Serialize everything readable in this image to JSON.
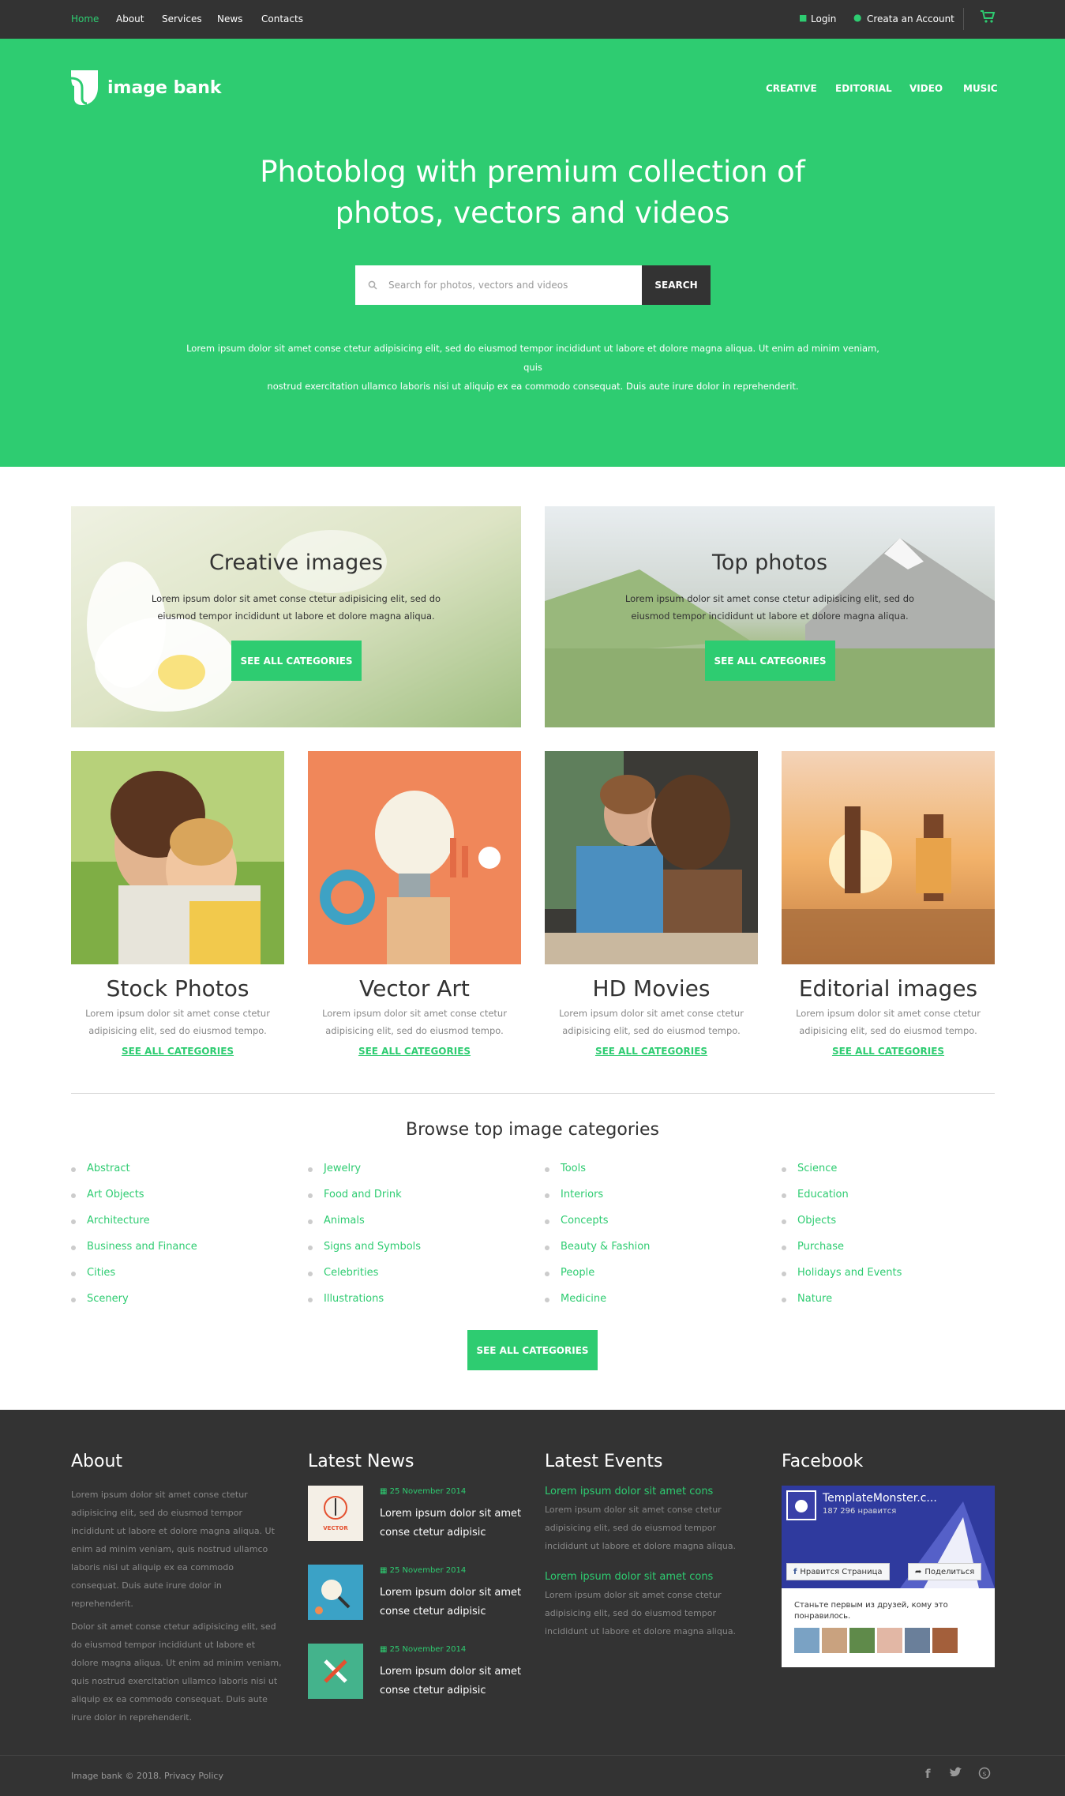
{
  "topbar": {
    "nav": [
      "Home",
      "About",
      "Services",
      "News",
      "Contacts"
    ],
    "login": "Login",
    "create_account": "Creata an Account"
  },
  "brand": {
    "name": "image bank"
  },
  "main_nav": [
    "CREATIVE",
    "EDITORIAL",
    "VIDEO",
    "MUSIC"
  ],
  "hero": {
    "title_line1": "Photoblog with premium collection of",
    "title_line2": "photos, vectors and videos",
    "search_placeholder": "Search for photos, vectors and videos",
    "search_button": "SEARCH",
    "text_line1": "Lorem ipsum dolor sit amet conse ctetur adipisicing elit, sed do eiusmod tempor incididunt ut labore et dolore magna aliqua. Ut enim ad minim veniam, quis",
    "text_line2": "nostrud exercitation ullamco laboris nisi ut aliquip ex ea commodo consequat. Duis aute irure dolor in reprehenderit."
  },
  "banners": [
    {
      "title": "Creative images",
      "text": "Lorem ipsum dolor sit amet conse ctetur adipisicing elit, sed do eiusmod tempor incididunt ut labore et dolore magna aliqua.",
      "button": "SEE ALL CATEGORIES"
    },
    {
      "title": "Top photos",
      "text": "Lorem ipsum dolor sit amet conse ctetur adipisicing elit, sed do eiusmod tempor incididunt ut labore et dolore magna aliqua.",
      "button": "SEE ALL CATEGORIES"
    }
  ],
  "cards": [
    {
      "title": "Stock Photos",
      "text": "Lorem ipsum dolor sit amet conse ctetur adipisicing elit, sed do eiusmod tempo.",
      "link": "SEE ALL CATEGORIES"
    },
    {
      "title": "Vector Art",
      "text": "Lorem ipsum dolor sit amet conse ctetur adipisicing elit, sed do eiusmod tempo.",
      "link": "SEE ALL CATEGORIES"
    },
    {
      "title": "HD Movies",
      "text": "Lorem ipsum dolor sit amet conse ctetur adipisicing elit, sed do eiusmod tempo.",
      "link": "SEE ALL CATEGORIES"
    },
    {
      "title": "Editorial images",
      "text": "Lorem ipsum dolor sit amet conse ctetur adipisicing elit, sed do eiusmod tempo.",
      "link": "SEE ALL CATEGORIES"
    }
  ],
  "browse": {
    "title": "Browse top image categories",
    "columns": [
      [
        "Abstract",
        "Art Objects",
        "Architecture",
        "Business and Finance",
        "Cities",
        "Scenery"
      ],
      [
        "Jewelry",
        "Food and Drink",
        "Animals",
        "Signs and Symbols",
        "Celebrities",
        "Illustrations"
      ],
      [
        "Tools",
        "Interiors",
        "Concepts",
        "Beauty & Fashion",
        "People",
        "Medicine"
      ],
      [
        "Science",
        "Education",
        "Objects",
        "Purchase",
        "Holidays and Events",
        "Nature"
      ]
    ],
    "button": "SEE ALL CATEGORIES"
  },
  "footer": {
    "about": {
      "title": "About",
      "p1": "Lorem ipsum dolor sit amet conse ctetur adipisicing elit, sed do eiusmod tempor incididunt ut labore et dolore magna aliqua. Ut enim ad minim veniam, quis nostrud ullamco laboris nisi ut aliquip ex ea commodo consequat. Duis aute irure dolor in reprehenderit.",
      "p2": "Dolor sit amet conse ctetur adipisicing elit, sed do eiusmod tempor incididunt ut labore et dolore magna aliqua. Ut enim ad minim veniam, quis nostrud exercitation ullamco laboris nisi ut aliquip ex ea commodo consequat. Duis aute irure dolor in reprehenderit."
    },
    "news": {
      "title": "Latest News",
      "items": [
        {
          "date": "25 November 2014",
          "title": "Lorem ipsum dolor sit amet conse ctetur adipisic",
          "thumb_text": "VECTOR"
        },
        {
          "date": "25 November 2014",
          "title": "Lorem ipsum dolor sit amet conse ctetur adipisic"
        },
        {
          "date": "25 November 2014",
          "title": "Lorem ipsum dolor sit amet conse ctetur adipisic"
        }
      ]
    },
    "events": {
      "title": "Latest Events",
      "items": [
        {
          "title": "Lorem ipsum dolor sit amet cons",
          "text": "Lorem ipsum dolor sit amet conse ctetur adipisicing elit, sed do eiusmod tempor incididunt ut labore et dolore magna aliqua."
        },
        {
          "title": "Lorem ipsum dolor sit amet cons",
          "text": "Lorem ipsum dolor sit amet conse ctetur adipisicing elit, sed do eiusmod tempor incididunt ut labore et dolore magna aliqua."
        }
      ]
    },
    "facebook": {
      "title": "Facebook",
      "page_name": "TemplateMonster.c...",
      "likes": "187 296 нравится",
      "like_button": "Нравится Страница",
      "share_button": "Поделиться",
      "friends_text": "Станьте первым из друзей, кому это понравилось."
    },
    "copyright": "Image bank © 2018. Privacy Policy"
  },
  "colors": {
    "accent": "#2ecc71",
    "dark": "#333333"
  }
}
